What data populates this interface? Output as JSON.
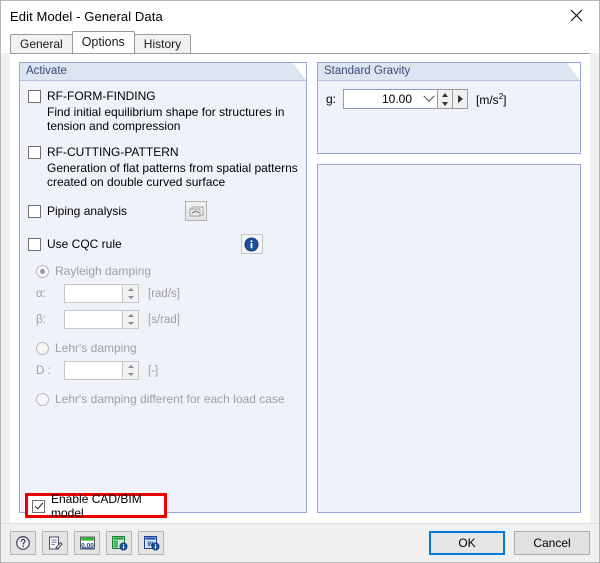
{
  "window": {
    "title": "Edit Model - General Data",
    "close_icon": "close-icon"
  },
  "tabs": [
    {
      "label": "General",
      "active": false
    },
    {
      "label": "Options",
      "active": true
    },
    {
      "label": "History",
      "active": false
    }
  ],
  "activate_group": {
    "title": "Activate",
    "items": [
      {
        "label": "RF-FORM-FINDING",
        "description": "Find initial equilibrium shape for structures in tension and compression",
        "checked": false
      },
      {
        "label": "RF-CUTTING-PATTERN",
        "description": "Generation of flat patterns from spatial patterns created on double curved surface",
        "checked": false
      }
    ],
    "piping": {
      "label": "Piping analysis",
      "checked": false,
      "button_icon": "piping-settings-icon"
    },
    "cqc": {
      "label": "Use CQC rule",
      "checked": false,
      "info_icon": "info-icon"
    },
    "damping": {
      "rayleigh": {
        "label": "Rayleigh damping",
        "selected": true
      },
      "alpha": {
        "label": "α:",
        "value": "",
        "unit": "[rad/s]"
      },
      "beta": {
        "label": "β:",
        "value": "",
        "unit": "[s/rad]"
      },
      "lehr": {
        "label": "Lehr's damping",
        "selected": false
      },
      "d": {
        "label": "D :",
        "value": "",
        "unit": "[-]"
      },
      "lehr_each": {
        "label": "Lehr's damping different for each load case",
        "selected": false
      }
    },
    "cad_bim": {
      "label": "Enable CAD/BIM model",
      "checked": true,
      "highlight_color": "#ef0000"
    }
  },
  "gravity_group": {
    "title": "Standard Gravity",
    "label": "g:",
    "value": "10.00",
    "unit_prefix": "[m/s",
    "unit_exponent": "2",
    "unit_suffix": "]"
  },
  "toolbar": {
    "buttons": [
      {
        "name": "help-icon",
        "title": "Help"
      },
      {
        "name": "edit-note-icon",
        "title": "Comment"
      },
      {
        "name": "calculator-icon",
        "title": "Units"
      },
      {
        "name": "excel-export-icon",
        "title": "Excel"
      },
      {
        "name": "word-export-icon",
        "title": "Word"
      }
    ]
  },
  "buttons": {
    "ok": "OK",
    "cancel": "Cancel"
  }
}
